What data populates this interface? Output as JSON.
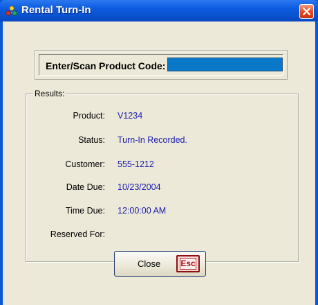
{
  "window": {
    "title": "Rental Turn-In"
  },
  "scan": {
    "label": "Enter/Scan Product Code:",
    "value": "",
    "field_color": "#0a78c8"
  },
  "results": {
    "legend": "Results:",
    "rows": [
      {
        "label": "Product:",
        "value": "V1234"
      },
      {
        "label": "Status:",
        "value": "Turn-In Recorded."
      },
      {
        "label": "Customer:",
        "value": "555-1212"
      },
      {
        "label": "Date Due:",
        "value": "10/23/2004"
      },
      {
        "label": "Time Due:",
        "value": "12:00:00 AM"
      },
      {
        "label": "Reserved For:",
        "value": ""
      }
    ],
    "value_color": "#1a1ab0"
  },
  "buttons": {
    "close_label": "Close",
    "esc_key": "Esc"
  },
  "icons": {
    "app": "colored-dots-app-icon",
    "window_close": "x-close-icon"
  }
}
